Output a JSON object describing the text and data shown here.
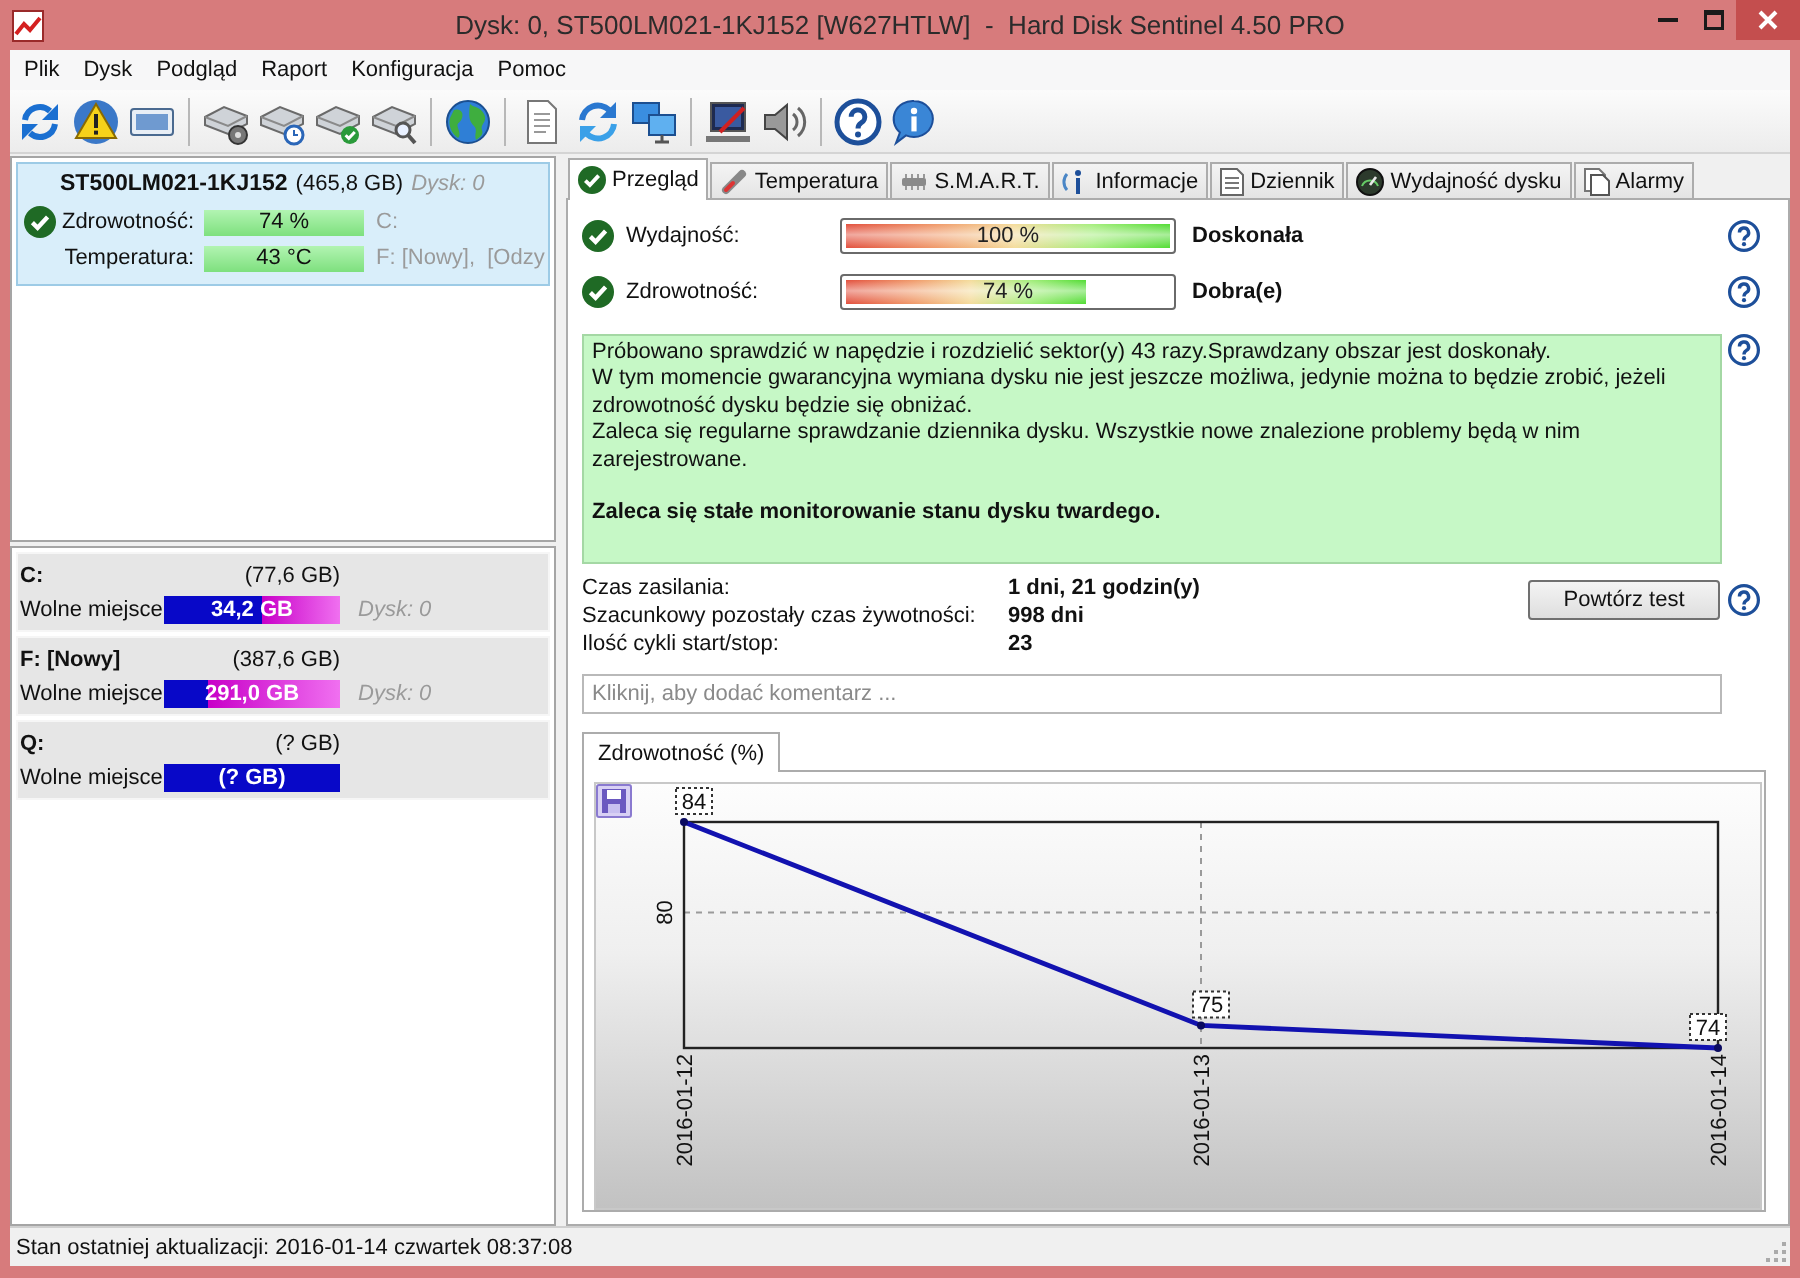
{
  "window": {
    "title": "Dysk: 0, ST500LM021-1KJ152 [W627HTLW]  -  Hard Disk Sentinel 4.50 PRO"
  },
  "menu": [
    "Plik",
    "Dysk",
    "Podgląd",
    "Raport",
    "Konfiguracja",
    "Pomoc"
  ],
  "disks": [
    {
      "name": "ST500LM021-1KJ152",
      "size": "(465,8 GB)",
      "disk_no": "Dysk: 0",
      "selected": true,
      "health_label": "Zdrowotność:",
      "health": "74 %",
      "temperature_label": "Temperatura:",
      "temperature": "43 °C",
      "volumes": [
        "C:",
        "F: [Nowy],  [Odzy"
      ]
    }
  ],
  "partitions": [
    {
      "letter": "C:",
      "size": "(77,6 GB)",
      "free_label": "Wolne miejsce",
      "free": "34,2 GB",
      "level": 0.44,
      "disk_no": "Dysk: 0"
    },
    {
      "letter": "F: [Nowy]",
      "size": "(387,6 GB)",
      "free_label": "Wolne miejsce",
      "free": "291,0 GB",
      "level": 0.75,
      "disk_no": "Dysk: 0"
    },
    {
      "letter": "Q:",
      "size": "(? GB)",
      "free_label": "Wolne miejsce",
      "free": "(? GB)"
    }
  ],
  "tabs": [
    {
      "label": "Przegląd",
      "selected": true
    },
    {
      "label": "Temperatura",
      "selected": false
    },
    {
      "label": "S.M.A.R.T.",
      "selected": false
    },
    {
      "label": "Informacje",
      "selected": false
    },
    {
      "label": "Dziennik",
      "selected": false
    },
    {
      "label": "Wydajność dysku",
      "selected": false
    },
    {
      "label": "Alarmy",
      "selected": false
    }
  ],
  "overview": {
    "ratings": [
      {
        "label": "Wydajność:",
        "level": 1,
        "reading": "100 %",
        "verdict": "Doskonała"
      },
      {
        "label": "Zdrowotność:",
        "level": 0.74,
        "reading": "74 %",
        "verdict": "Dobra(e)"
      }
    ],
    "message": [
      "Próbowano sprawdzić w napędzie i rozdzielić sektor(y) 43 razy.Sprawdzany obszar jest doskonały.",
      "W tym momencie gwarancyjna wymiana dysku nie jest jeszcze możliwa, jedynie można to będzie zrobić, jeżeli zdrowotność dysku będzie się obniżać.",
      "Zaleca się regularne sprawdzanie dziennika dysku. Wszystkie nowe znalezione problemy będą w nim zarejestrowane."
    ],
    "recommendation": "Zaleca się stałe monitorowanie stanu dysku twardego.",
    "facts": [
      {
        "label": "Czas zasilania:",
        "value": "1 dni, 21 godzin(y)"
      },
      {
        "label": "Szacunkowy pozostały czas żywotności:",
        "value": "998 dni"
      },
      {
        "label": "Ilość cykli start/stop:",
        "value": "23"
      }
    ],
    "retest_button": "Powtórz test",
    "comment": {
      "placeholder": "Kliknij, aby dodać komentarz ..."
    }
  },
  "chart": {
    "tabs": [
      {
        "label": "Zdrowotność (%)",
        "selected": true
      }
    ],
    "chart_data": {
      "type": "line",
      "categories": [
        "2016-01-12",
        "2016-01-13",
        "2016-01-14"
      ],
      "series": [
        {
          "color": "#1212b0",
          "marker": "dot",
          "values": [
            84,
            75,
            74
          ]
        }
      ],
      "data_labels": true,
      "ref_lines": [
        {
          "axis": "y",
          "value": 80,
          "label": "80"
        }
      ]
    }
  },
  "status_bar": {
    "text": "Stan ostatniej aktualizacji: 2016-01-14 czwartek 08:37:08"
  }
}
